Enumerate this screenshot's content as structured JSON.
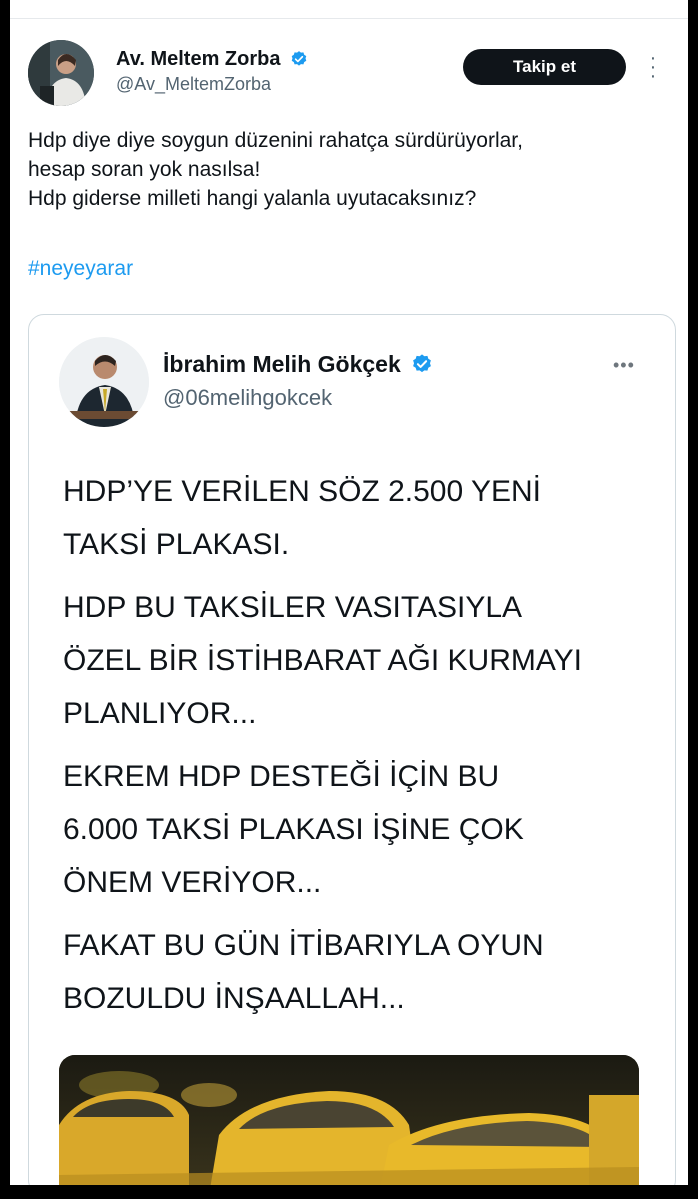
{
  "tweet": {
    "author_name": "Av. Meltem Zorba",
    "author_handle": "@Av_MeltemZorba",
    "follow_label": "Takip et",
    "more_icon": "vertical-dots-icon",
    "text_lines": [
      "Hdp diye diye soygun düzenini rahatça sürdürüyorlar,",
      "hesap soran yok nasılsa!",
      "Hdp giderse milleti hangi yalanla uyutacaksınız?"
    ],
    "hashtag": "#neyeyarar"
  },
  "quoted_tweet": {
    "author_name": "İbrahim Melih Gökçek",
    "author_handle": "@06melihgokcek",
    "more_icon": "horizontal-dots-icon",
    "paragraphs": [
      [
        "HDP’YE VERİLEN SÖZ 2.500 YENİ",
        "TAKSİ PLAKASI."
      ],
      [
        "HDP BU TAKSİLER VASITASIYLA",
        "ÖZEL BİR İSTİHBARAT AĞI KURMAYI",
        "PLANLIYOR..."
      ],
      [
        "EKREM HDP DESTEĞİ İÇİN BU",
        "6.000 TAKSİ PLAKASI İŞİNE ÇOK",
        "ÖNEM VERİYOR..."
      ],
      [
        "FAKAT BU GÜN İTİBARIYLA OYUN",
        "BOZULDU İNŞAALLAH..."
      ]
    ]
  },
  "colors": {
    "accent": "#1d9bf0",
    "verified": "#1d9bf0",
    "text": "#0f1419",
    "secondary": "#536471",
    "taxi_yellow": "#e8b92a"
  }
}
